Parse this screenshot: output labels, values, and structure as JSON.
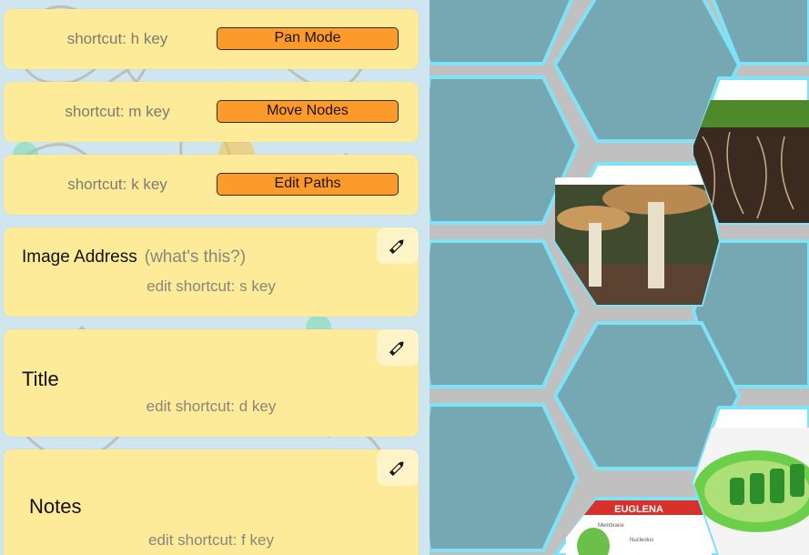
{
  "colors": {
    "card_bg": "#fdeb9a",
    "button_bg": "#fd9a2c",
    "hex_fill": "#76a8b3",
    "hex_border": "#7ee3f7",
    "grid_bg": "#c0c0c0"
  },
  "mode_buttons": [
    {
      "shortcut": "shortcut: h key",
      "label": "Pan Mode"
    },
    {
      "shortcut": "shortcut: m key",
      "label": "Move Nodes"
    },
    {
      "shortcut": "shortcut: k key",
      "label": "Edit Paths"
    }
  ],
  "fields": {
    "image_address": {
      "label": "Image Address",
      "help": "(what's this?)",
      "shortcut": "edit shortcut: s key",
      "icon": "pencil-icon"
    },
    "title": {
      "label": "Title",
      "shortcut": "edit shortcut: d key",
      "icon": "pencil-icon"
    },
    "notes": {
      "label": "Notes",
      "shortcut": "edit shortcut: f key",
      "icon": "pencil-icon"
    }
  },
  "hex_images": {
    "mushroom": "mushroom-photo",
    "roots": "plant-roots-photo",
    "euglena_title": "EUGLENA",
    "euglena_labels": [
      "Membrane",
      "Nucleolus"
    ],
    "chloroplast": "chloroplast-diagram"
  }
}
